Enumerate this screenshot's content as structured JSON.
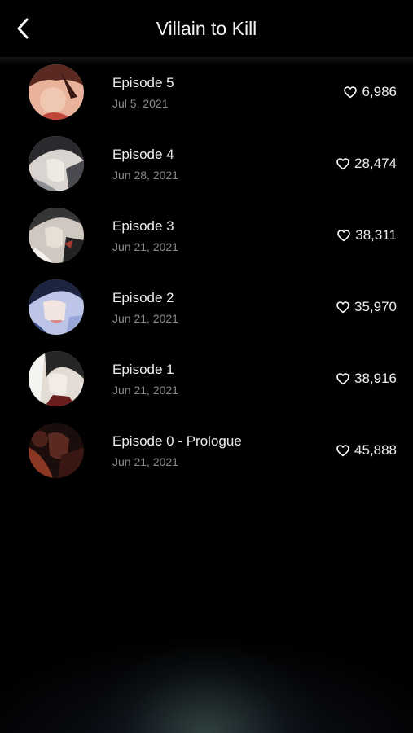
{
  "header": {
    "title": "Villain to Kill",
    "back_icon": "chevron-left-icon"
  },
  "episodes": [
    {
      "title": "Episode 5",
      "date": "Jul 5, 2021",
      "likes": "6,986",
      "thumb_colors": [
        "#e8b39a",
        "#5a2a22",
        "#c0463a"
      ]
    },
    {
      "title": "Episode 4",
      "date": "Jun 28, 2021",
      "likes": "28,474",
      "thumb_colors": [
        "#d9d4d0",
        "#2a2a2e",
        "#8e8f96"
      ]
    },
    {
      "title": "Episode 3",
      "date": "Jun 21, 2021",
      "likes": "38,311",
      "thumb_colors": [
        "#cfc8c0",
        "#353535",
        "#a63a2e"
      ]
    },
    {
      "title": "Episode 2",
      "date": "Jun 21, 2021",
      "likes": "35,970",
      "thumb_colors": [
        "#bcc4e8",
        "#1d2440",
        "#d88a8a"
      ]
    },
    {
      "title": "Episode 1",
      "date": "Jun 21, 2021",
      "likes": "38,916",
      "thumb_colors": [
        "#e2dcd4",
        "#262626",
        "#6b1e1e"
      ]
    },
    {
      "title": "Episode 0 - Prologue",
      "date": "Jun 21, 2021",
      "likes": "45,888",
      "thumb_colors": [
        "#5a2a22",
        "#1a0d0b",
        "#b0452c"
      ]
    }
  ],
  "like_icon": "heart-outline-icon"
}
